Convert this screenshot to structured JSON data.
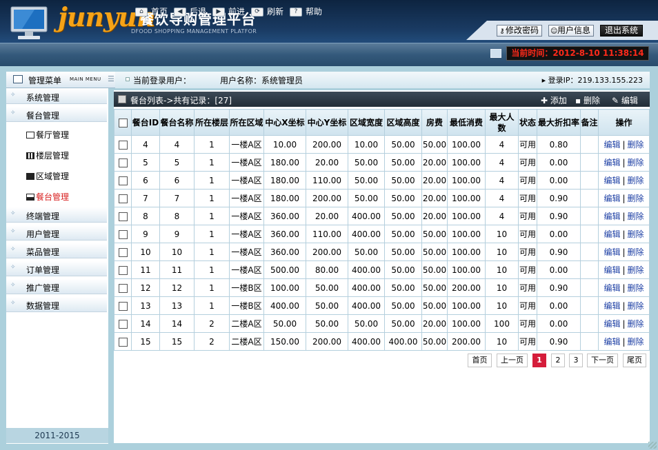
{
  "header": {
    "brand_en": "junyun",
    "brand_cn": "餐饮导购管理平台",
    "brand_sub": "DFOOD SHOPPING MANAGEMENT PLATFOR",
    "top_buttons": {
      "change_password": "修改密码",
      "user_info": "用户信息",
      "logout": "退出系统"
    },
    "nav": {
      "home": "首页",
      "back": "后退",
      "forward": "前进",
      "refresh": "刷新",
      "help": "帮助"
    },
    "current_time": "当前时间：2012-8-10 11:38:14"
  },
  "sidebar": {
    "title": "管理菜单",
    "title_en": "MAIN MENU",
    "items": [
      {
        "label": "系统管理"
      },
      {
        "label": "餐台管理"
      },
      {
        "label": "终端管理"
      },
      {
        "label": "用户管理"
      },
      {
        "label": "菜品管理"
      },
      {
        "label": "订单管理"
      },
      {
        "label": "推广管理"
      },
      {
        "label": "数据管理"
      }
    ],
    "subitems": [
      {
        "label": "餐厅管理"
      },
      {
        "label": "楼层管理"
      },
      {
        "label": "区域管理"
      },
      {
        "label": "餐台管理"
      }
    ],
    "copyright": "2011-2015"
  },
  "info_bar": {
    "current_user_label": "当前登录用户：",
    "username": "用户名称：系统管理员",
    "login_ip": "登录IP：219.133.155.223"
  },
  "list": {
    "title": "餐台列表->共有记录：[27]",
    "actions": {
      "add": "添加",
      "delete": "删除",
      "edit": "编辑"
    },
    "columns": [
      "餐台ID",
      "餐台名称",
      "所在楼层",
      "所在区域",
      "中心X坐标",
      "中心Y坐标",
      "区域宽度",
      "区域高度",
      "房费",
      "最低消费",
      "最大人数",
      "状态",
      "最大折扣率",
      "备注",
      "操作"
    ],
    "op_edit": "编辑",
    "op_delete": "删除",
    "op_sep": "|",
    "rows": [
      [
        "4",
        "4",
        "1",
        "一楼A区",
        "10.00",
        "200.00",
        "10.00",
        "50.00",
        "50.00",
        "100.00",
        "4",
        "可用",
        "0.80",
        ""
      ],
      [
        "5",
        "5",
        "1",
        "一楼A区",
        "180.00",
        "20.00",
        "50.00",
        "50.00",
        "20.00",
        "100.00",
        "4",
        "可用",
        "0.00",
        ""
      ],
      [
        "6",
        "6",
        "1",
        "一楼A区",
        "180.00",
        "110.00",
        "50.00",
        "50.00",
        "20.00",
        "100.00",
        "4",
        "可用",
        "0.00",
        ""
      ],
      [
        "7",
        "7",
        "1",
        "一楼A区",
        "180.00",
        "200.00",
        "50.00",
        "50.00",
        "20.00",
        "100.00",
        "4",
        "可用",
        "0.90",
        ""
      ],
      [
        "8",
        "8",
        "1",
        "一楼A区",
        "360.00",
        "20.00",
        "400.00",
        "50.00",
        "20.00",
        "100.00",
        "4",
        "可用",
        "0.90",
        ""
      ],
      [
        "9",
        "9",
        "1",
        "一楼A区",
        "360.00",
        "110.00",
        "400.00",
        "50.00",
        "50.00",
        "100.00",
        "10",
        "可用",
        "0.00",
        ""
      ],
      [
        "10",
        "10",
        "1",
        "一楼A区",
        "360.00",
        "200.00",
        "50.00",
        "50.00",
        "50.00",
        "100.00",
        "10",
        "可用",
        "0.90",
        ""
      ],
      [
        "11",
        "11",
        "1",
        "一楼A区",
        "500.00",
        "80.00",
        "400.00",
        "50.00",
        "50.00",
        "100.00",
        "10",
        "可用",
        "0.00",
        ""
      ],
      [
        "12",
        "12",
        "1",
        "一楼B区",
        "100.00",
        "50.00",
        "400.00",
        "50.00",
        "50.00",
        "200.00",
        "10",
        "可用",
        "0.90",
        ""
      ],
      [
        "13",
        "13",
        "1",
        "一楼B区",
        "400.00",
        "50.00",
        "400.00",
        "50.00",
        "50.00",
        "100.00",
        "10",
        "可用",
        "0.00",
        ""
      ],
      [
        "14",
        "14",
        "2",
        "二楼A区",
        "50.00",
        "50.00",
        "50.00",
        "50.00",
        "20.00",
        "100.00",
        "100",
        "可用",
        "0.00",
        ""
      ],
      [
        "15",
        "15",
        "2",
        "二楼A区",
        "150.00",
        "200.00",
        "400.00",
        "400.00",
        "50.00",
        "200.00",
        "10",
        "可用",
        "0.90",
        ""
      ]
    ]
  },
  "pager": {
    "first": "首页",
    "prev": "上一页",
    "pages": [
      "1",
      "2",
      "3"
    ],
    "current": "1",
    "next": "下一页",
    "last": "尾页"
  },
  "colors": {
    "accent": "#f6a317",
    "time_text": "#ff2a1a",
    "active_menu": "#d81f1f",
    "current_page": "#d51d3b"
  }
}
